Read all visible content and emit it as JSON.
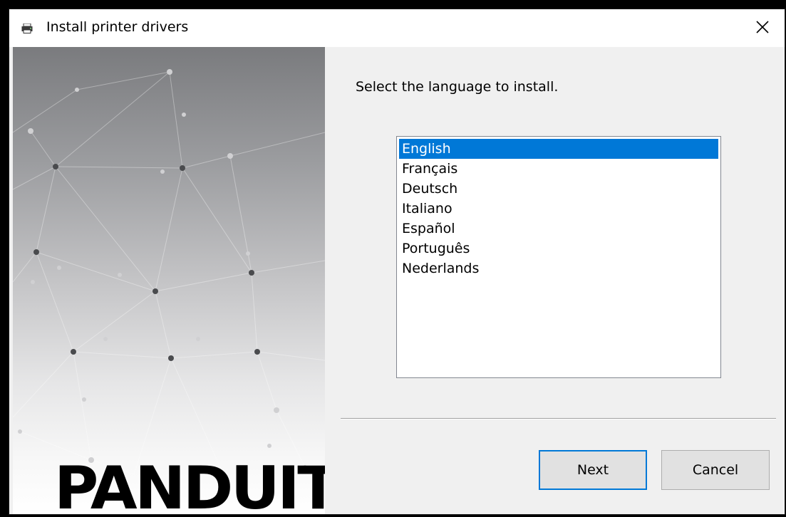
{
  "window": {
    "title": "Install printer drivers",
    "close_glyph": "✕",
    "app_icon": "printer-icon"
  },
  "side_panel": {
    "logo_text": "PANDUIT"
  },
  "main": {
    "prompt": "Select the language to install.",
    "languages": [
      {
        "label": "English",
        "selected": true
      },
      {
        "label": "Français",
        "selected": false
      },
      {
        "label": "Deutsch",
        "selected": false
      },
      {
        "label": "Italiano",
        "selected": false
      },
      {
        "label": "Español",
        "selected": false
      },
      {
        "label": "Português",
        "selected": false
      },
      {
        "label": "Nederlands",
        "selected": false
      }
    ]
  },
  "buttons": {
    "next_label": "Next",
    "cancel_label": "Cancel"
  },
  "colors": {
    "selection": "#0078d7",
    "default_button_border": "#0078d7",
    "button_face": "#e1e1e1"
  }
}
